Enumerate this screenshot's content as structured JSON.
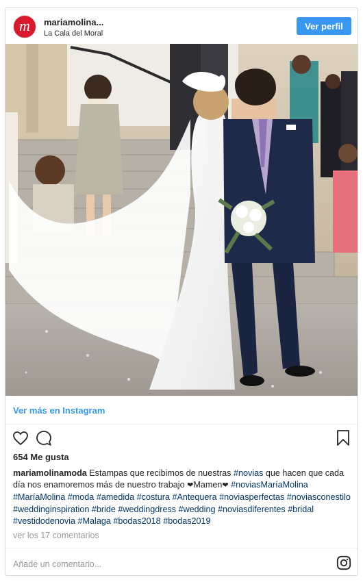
{
  "header": {
    "avatar_letter": "m",
    "username": "mariamolina...",
    "location": "La Cala del Moral",
    "follow_label": "Ver perfil"
  },
  "post": {
    "image_alt": "Wedding couple kissing on church steps",
    "view_more_label": "Ver más en Instagram",
    "likes": "654 Me gusta",
    "caption_user": "mariamolinamoda",
    "caption_parts": [
      "Estampas que recibimos de nuestras ",
      "#novias",
      " que hacen que cada día nos enamoremos más de nuestro trabajo ",
      "❤",
      "Mamen",
      "❤",
      " ",
      "#noviasMaríaMolina",
      " ",
      "#MaríaMolina",
      " ",
      "#moda",
      " ",
      "#amedida",
      " ",
      "#costura",
      " ",
      "#Antequera",
      " ",
      "#noviasperfectas",
      " ",
      "#noviasconestilo",
      " ",
      "#weddinginspiration",
      " ",
      "#bride",
      " ",
      "#weddingdress",
      " ",
      "#wedding",
      " ",
      "#noviasdiferentes",
      " ",
      "#bridal",
      " ",
      "#vestidodenovia",
      " ",
      "#Malaga",
      " ",
      "#bodas2018",
      " ",
      "#bodas2019"
    ],
    "view_comments": "ver los 17 comentarios",
    "add_comment_placeholder": "Añade un comentario..."
  },
  "colors": {
    "accent_blue": "#3897f0",
    "hashtag": "#003569",
    "avatar_red": "#d8192e",
    "muted": "#999999"
  },
  "icons": [
    "heart-icon",
    "comment-icon",
    "bookmark-icon",
    "instagram-icon"
  ]
}
